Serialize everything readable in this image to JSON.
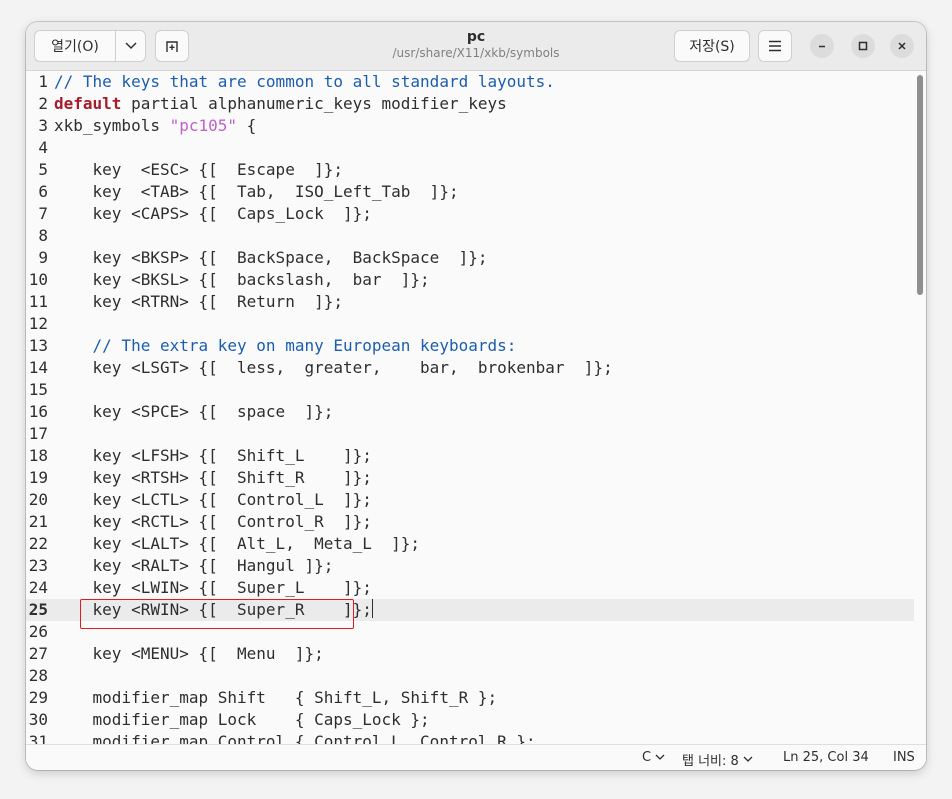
{
  "header": {
    "open_label": "열기(O)",
    "save_label": "저장(S)",
    "title": "pc",
    "subtitle": "/usr/share/X11/xkb/symbols"
  },
  "icons": {
    "open_menu": "chevron-down-icon",
    "new_tab": "new-tab-icon",
    "main_menu": "hamburger-menu-icon",
    "minimize": "minimize-icon",
    "maximize": "maximize-icon",
    "close": "close-icon"
  },
  "colors": {
    "comment": "#1c5dad",
    "keyword": "#a51d2d",
    "string": "#c061cb",
    "highlight_box": "#e01b24"
  },
  "editor": {
    "current_line": 25,
    "lines": [
      {
        "n": "1",
        "text": "// The keys that are common to all standard layouts.",
        "type": "comment"
      },
      {
        "n": "2",
        "kw": "default",
        "text": " partial alphanumeric_keys modifier_keys",
        "type": "kw"
      },
      {
        "n": "3",
        "pre": "xkb_symbols ",
        "str": "\"pc105\"",
        "post": " {",
        "type": "str"
      },
      {
        "n": "4",
        "text": "",
        "type": "plain"
      },
      {
        "n": "5",
        "text": "    key  <ESC> {[  Escape  ]};",
        "type": "plain"
      },
      {
        "n": "6",
        "text": "    key  <TAB> {[  Tab,  ISO_Left_Tab  ]};",
        "type": "plain"
      },
      {
        "n": "7",
        "text": "    key <CAPS> {[  Caps_Lock  ]};",
        "type": "plain"
      },
      {
        "n": "8",
        "text": "",
        "type": "plain"
      },
      {
        "n": "9",
        "text": "    key <BKSP> {[  BackSpace,  BackSpace  ]};",
        "type": "plain"
      },
      {
        "n": "10",
        "text": "    key <BKSL> {[  backslash,  bar  ]};",
        "type": "plain"
      },
      {
        "n": "11",
        "text": "    key <RTRN> {[  Return  ]};",
        "type": "plain"
      },
      {
        "n": "12",
        "text": "",
        "type": "plain"
      },
      {
        "n": "13",
        "text": "    // The extra key on many European keyboards:",
        "type": "comment"
      },
      {
        "n": "14",
        "text": "    key <LSGT> {[  less,  greater,    bar,  brokenbar  ]};",
        "type": "plain"
      },
      {
        "n": "15",
        "text": "",
        "type": "plain"
      },
      {
        "n": "16",
        "text": "    key <SPCE> {[  space  ]};",
        "type": "plain"
      },
      {
        "n": "17",
        "text": "",
        "type": "plain"
      },
      {
        "n": "18",
        "text": "    key <LFSH> {[  Shift_L    ]};",
        "type": "plain"
      },
      {
        "n": "19",
        "text": "    key <RTSH> {[  Shift_R    ]};",
        "type": "plain"
      },
      {
        "n": "20",
        "text": "    key <LCTL> {[  Control_L  ]};",
        "type": "plain"
      },
      {
        "n": "21",
        "text": "    key <RCTL> {[  Control_R  ]};",
        "type": "plain"
      },
      {
        "n": "22",
        "text": "    key <LALT> {[  Alt_L,  Meta_L  ]};",
        "type": "plain"
      },
      {
        "n": "23",
        "text": "    key <RALT> {[  Hangul ]};",
        "type": "plain"
      },
      {
        "n": "24",
        "text": "    key <LWIN> {[  Super_L    ]};",
        "type": "plain"
      },
      {
        "n": "25",
        "text": "    key <RWIN> {[  Super_R    ]};",
        "type": "plain"
      },
      {
        "n": "26",
        "text": "",
        "type": "plain"
      },
      {
        "n": "27",
        "text": "    key <MENU> {[  Menu  ]};",
        "type": "plain"
      },
      {
        "n": "28",
        "text": "",
        "type": "plain"
      },
      {
        "n": "29",
        "text": "    modifier_map Shift   { Shift_L, Shift_R };",
        "type": "plain"
      },
      {
        "n": "30",
        "text": "    modifier_map Lock    { Caps_Lock };",
        "type": "plain"
      },
      {
        "n": "31",
        "text": "    modifier_map Control { Control_L, Control_R };",
        "type": "plain"
      }
    ]
  },
  "status": {
    "language": "C",
    "tab_width": "탭 너비: 8",
    "cursor": "Ln 25, Col 34",
    "mode": "INS"
  }
}
